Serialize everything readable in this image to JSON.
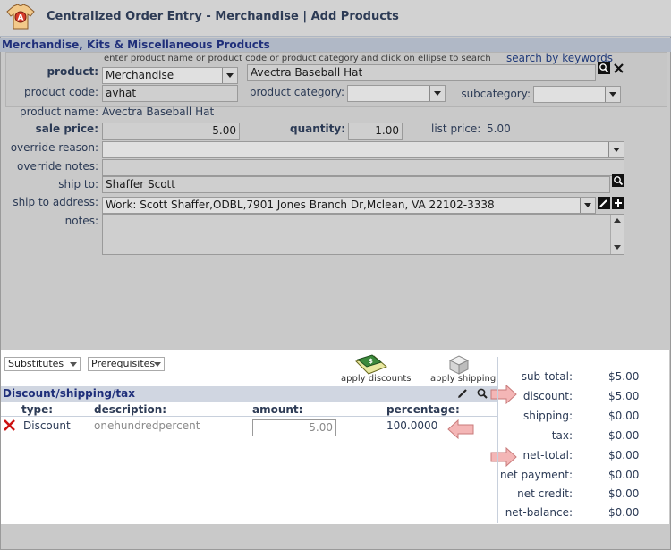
{
  "window": {
    "title": "Centralized Order Entry - Merchandise | Add Products"
  },
  "section_title": "Merchandise, Kits & Miscellaneous Products",
  "search_hint": "enter product name or product code or product category and click on ellipse to search",
  "search_link": "search by keywords",
  "product": {
    "label": "product:",
    "type_value": "Merchandise",
    "name_value": "Avectra Baseball Hat"
  },
  "product_code": {
    "label": "product code:",
    "value": "avhat"
  },
  "product_category": {
    "label": "product category:",
    "value": ""
  },
  "subcategory": {
    "label": "subcategory:",
    "value": ""
  },
  "product_name": {
    "label": "product name:",
    "value": "Avectra Baseball Hat"
  },
  "sale_price": {
    "label": "sale price:",
    "value": "5.00"
  },
  "quantity": {
    "label": "quantity:",
    "value": "1.00"
  },
  "list_price": {
    "label": "list price:",
    "value": "5.00"
  },
  "override_reason": {
    "label": "override reason:",
    "value": ""
  },
  "override_notes": {
    "label": "override notes:",
    "value": ""
  },
  "ship_to": {
    "label": "ship to:",
    "value": "Shaffer Scott"
  },
  "ship_to_address": {
    "label": "ship to address:",
    "value": "Work: Scott Shaffer,ODBL,7901 Jones Branch Dr,Mclean, VA 22102-3338"
  },
  "notes": {
    "label": "notes:",
    "value": ""
  },
  "dropdowns": {
    "substitutes": "Substitutes",
    "prerequisites": "Prerequisites"
  },
  "actions": {
    "apply_discounts": "apply discounts",
    "apply_shipping": "apply shipping"
  },
  "discount_section": {
    "title": "Discount/shipping/tax",
    "columns": [
      "type:",
      "description:",
      "amount:",
      "percentage:"
    ],
    "rows": [
      {
        "type": "Discount",
        "description": "onehundredpercent",
        "amount": "5.00",
        "percentage": "100.0000"
      }
    ]
  },
  "totals": [
    {
      "label": "sub-total:",
      "value": "$5.00"
    },
    {
      "label": "discount:",
      "value": "$5.00"
    },
    {
      "label": "shipping:",
      "value": "$0.00"
    },
    {
      "label": "tax:",
      "value": "$0.00"
    },
    {
      "label": "net-total:",
      "value": "$0.00"
    },
    {
      "label": "net payment:",
      "value": "$0.00"
    },
    {
      "label": "net credit:",
      "value": "$0.00"
    },
    {
      "label": "net-balance:",
      "value": "$0.00"
    }
  ],
  "colors": {
    "section_bar": "#b0b8c6",
    "title_text": "#1f2f7a",
    "callout": "#f4b6b6",
    "delete_x": "#cc1111"
  },
  "icons": [
    "app-shirt-icon",
    "magnifier-icon",
    "close-icon",
    "pencil-icon",
    "plus-icon",
    "delete-x-icon",
    "apply-discounts-icon",
    "apply-shipping-icon",
    "callout-arrow-icon"
  ]
}
